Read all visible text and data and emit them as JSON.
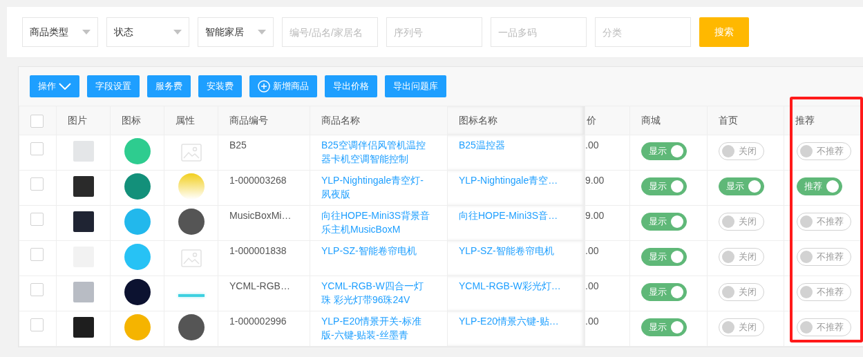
{
  "filters": [
    {
      "kind": "select",
      "value": "商品类型"
    },
    {
      "kind": "select",
      "value": "状态"
    },
    {
      "kind": "select",
      "value": "智能家居"
    },
    {
      "kind": "input",
      "placeholder": "编号/品名/家居名"
    },
    {
      "kind": "input",
      "placeholder": "序列号"
    },
    {
      "kind": "input",
      "placeholder": "一品多码"
    },
    {
      "kind": "input",
      "placeholder": "分类"
    }
  ],
  "search_button": "搜索",
  "toolbar": [
    {
      "label": "操作",
      "kind": "dropdown"
    },
    {
      "label": "字段设置",
      "kind": "plain"
    },
    {
      "label": "服务费",
      "kind": "plain"
    },
    {
      "label": "安装费",
      "kind": "plain"
    },
    {
      "label": "新增商品",
      "kind": "add"
    },
    {
      "label": "导出价格",
      "kind": "plain"
    },
    {
      "label": "导出问题库",
      "kind": "plain"
    }
  ],
  "table": {
    "select_all": {
      "checked": false
    },
    "columns": [
      "图片",
      "图标",
      "属性",
      "商品编号",
      "商品名称",
      "图标名称",
      "价",
      "商城",
      "首页",
      "推荐"
    ],
    "rows": [
      {
        "checked": false,
        "code": "B25",
        "name": "B25空调伴侣风管机温控器卡机空调智能控制",
        "icon_name": "B25温控器",
        "price": ".00",
        "mall": {
          "on": true,
          "label": "显示"
        },
        "home": {
          "on": false,
          "label": "关闭"
        },
        "recommend": {
          "on": false,
          "label": "不推荐"
        }
      },
      {
        "checked": false,
        "code": "1-000003268",
        "name": "YLP-Nightingale青空灯-夙夜版",
        "icon_name": "YLP-Nightingale青空…",
        "price": "9.00",
        "mall": {
          "on": true,
          "label": "显示"
        },
        "home": {
          "on": true,
          "label": "显示"
        },
        "recommend": {
          "on": true,
          "label": "推荐"
        }
      },
      {
        "checked": false,
        "code": "MusicBoxMi…",
        "name": "向往HOPE-Mini3S背景音乐主机MusicBoxM",
        "icon_name": "向往HOPE-Mini3S音…",
        "price": "9.00",
        "mall": {
          "on": true,
          "label": "显示"
        },
        "home": {
          "on": false,
          "label": "关闭"
        },
        "recommend": {
          "on": false,
          "label": "不推荐"
        }
      },
      {
        "checked": false,
        "code": "1-000001838",
        "name": "YLP-SZ-智能卷帘电机",
        "icon_name": "YLP-SZ-智能卷帘电机",
        "price": ".00",
        "mall": {
          "on": true,
          "label": "显示"
        },
        "home": {
          "on": false,
          "label": "关闭"
        },
        "recommend": {
          "on": false,
          "label": "不推荐"
        }
      },
      {
        "checked": false,
        "code": "YCML-RGB…",
        "name": "YCML-RGB-W四合一灯珠 彩光灯带96珠24V",
        "icon_name": "YCML-RGB-W彩光灯…",
        "price": ".00",
        "mall": {
          "on": true,
          "label": "显示"
        },
        "home": {
          "on": false,
          "label": "关闭"
        },
        "recommend": {
          "on": false,
          "label": "不推荐"
        }
      },
      {
        "checked": false,
        "code": "1-000002996",
        "name": "YLP-E20情景开关-标准版-六键-贴装-丝墨青",
        "icon_name": "YLP-E20情景六键-贴…",
        "price": ".00",
        "mall": {
          "on": true,
          "label": "显示"
        },
        "home": {
          "on": false,
          "label": "关闭"
        },
        "recommend": {
          "on": false,
          "label": "不推荐"
        }
      }
    ]
  }
}
